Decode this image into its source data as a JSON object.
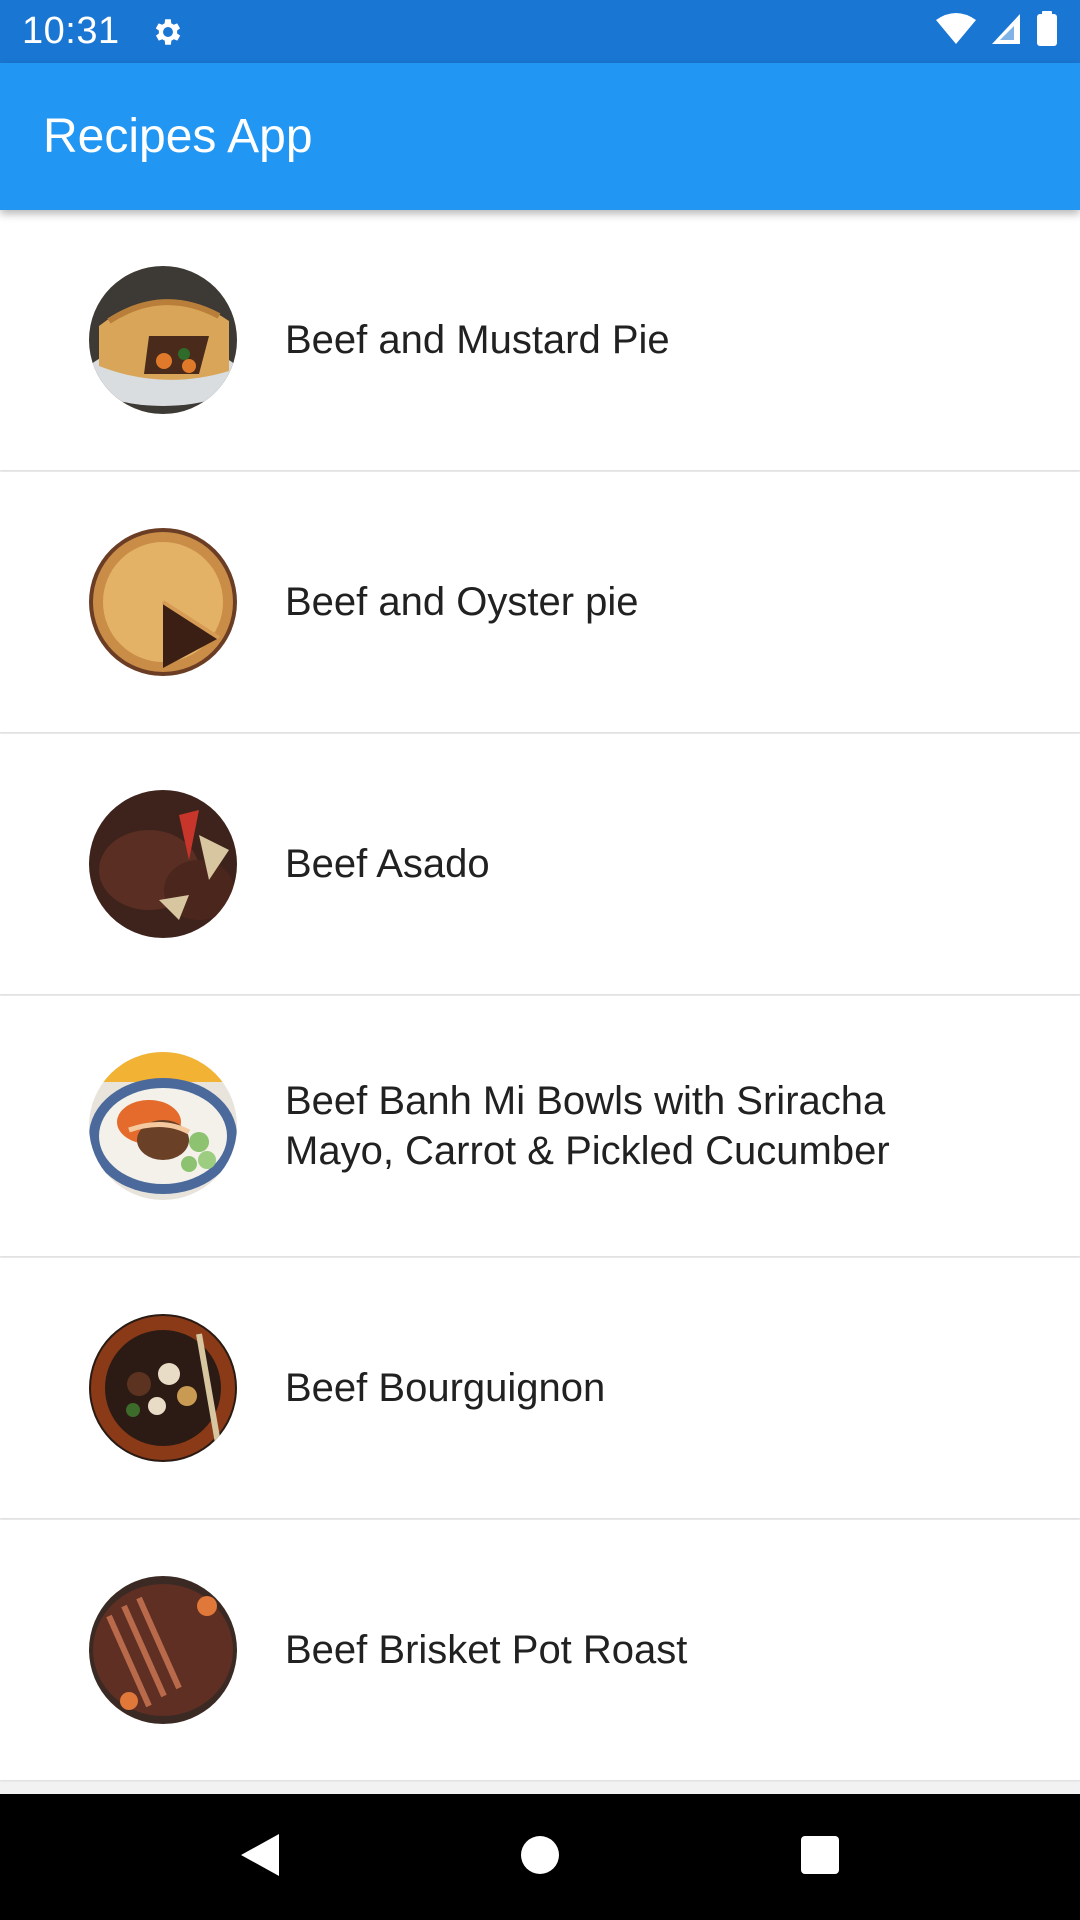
{
  "status_bar": {
    "time": "10:31",
    "icons": [
      "settings-gear-icon",
      "wifi-icon",
      "cell-signal-icon",
      "battery-icon"
    ],
    "background_color": "#1976D2"
  },
  "app_bar": {
    "title": "Recipes App",
    "background_color": "#2196F3"
  },
  "recipes": [
    {
      "name": "Beef and Mustard Pie",
      "thumb_icon": "beef-mustard-pie-image"
    },
    {
      "name": "Beef and Oyster pie",
      "thumb_icon": "beef-oyster-pie-image"
    },
    {
      "name": "Beef Asado",
      "thumb_icon": "beef-asado-image"
    },
    {
      "name": "Beef Banh Mi Bowls with Sriracha Mayo, Carrot & Pickled Cucumber",
      "thumb_icon": "beef-banh-mi-bowl-image"
    },
    {
      "name": "Beef Bourguignon",
      "thumb_icon": "beef-bourguignon-image"
    },
    {
      "name": "Beef Brisket Pot Roast",
      "thumb_icon": "beef-brisket-image"
    }
  ],
  "nav_bar": {
    "buttons": [
      "back-icon",
      "home-icon",
      "recents-icon"
    ]
  }
}
